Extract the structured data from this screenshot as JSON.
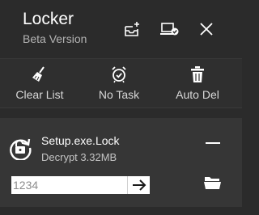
{
  "header": {
    "title": "Locker",
    "subtitle": "Beta Version",
    "icons": [
      "inbox-add-icon",
      "laptop-check-icon",
      "close-icon"
    ]
  },
  "toolbar": {
    "items": [
      {
        "label": "Clear List",
        "icon": "broom-icon"
      },
      {
        "label": "No Task",
        "icon": "alarm-clock-icon"
      },
      {
        "label": "Auto Del",
        "icon": "trash-icon"
      }
    ]
  },
  "task": {
    "name": "Setup.exe.Lock",
    "status": "Decrypt 3.32MB",
    "password_value": "1234",
    "icons": [
      "unlock-refresh-icon",
      "minus-icon",
      "arrow-right-icon",
      "folder-open-icon"
    ]
  },
  "colors": {
    "background": "#2b2b2b",
    "toolbar": "#2f2f2f",
    "task_panel": "#363636",
    "text": "#ffffff",
    "muted_text": "#b4b4b4"
  }
}
